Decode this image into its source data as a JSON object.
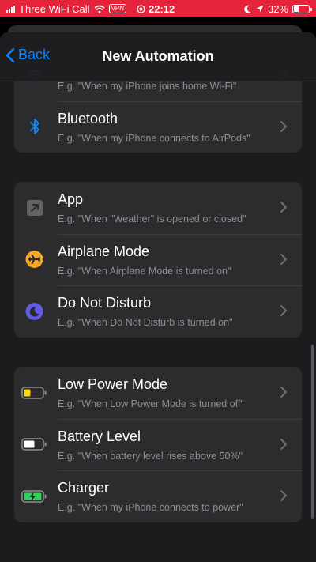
{
  "status": {
    "carrier": "Three WiFi Call",
    "vpn": "VPN",
    "time": "22:12",
    "battery": "32%",
    "battery_level": 0.32
  },
  "nav": {
    "back_label": "Back",
    "title": "New Automation"
  },
  "groups": [
    {
      "rows": [
        {
          "title": "",
          "subtitle": "E.g. \"When my iPhone joins home Wi-Fi\"",
          "icon": "wifi-icon"
        },
        {
          "title": "Bluetooth",
          "subtitle": "E.g. \"When my iPhone connects to AirPods\"",
          "icon": "bluetooth-icon"
        }
      ]
    },
    {
      "rows": [
        {
          "title": "App",
          "subtitle": "E.g. \"When \"Weather\" is opened or closed\"",
          "icon": "app-arrow-icon"
        },
        {
          "title": "Airplane Mode",
          "subtitle": "E.g. \"When Airplane Mode is turned on\"",
          "icon": "airplane-icon",
          "color": "#f5a623"
        },
        {
          "title": "Do Not Disturb",
          "subtitle": "E.g. \"When Do Not Disturb is turned on\"",
          "icon": "moon-icon",
          "color": "#5e5ce6"
        }
      ]
    },
    {
      "rows": [
        {
          "title": "Low Power Mode",
          "subtitle": "E.g. \"When Low Power Mode is turned off\"",
          "icon": "battery-low-power-icon",
          "color": "#ffd60a"
        },
        {
          "title": "Battery Level",
          "subtitle": "E.g. \"When battery level rises above 50%\"",
          "icon": "battery-level-icon"
        },
        {
          "title": "Charger",
          "subtitle": "E.g. \"When my iPhone connects to power\"",
          "icon": "battery-charging-icon",
          "color": "#30d158"
        }
      ]
    }
  ],
  "colors": {
    "status_bar": "#e5243b",
    "accent": "#0a84ff",
    "background": "#1c1c1e",
    "cell": "#2c2c2e"
  }
}
